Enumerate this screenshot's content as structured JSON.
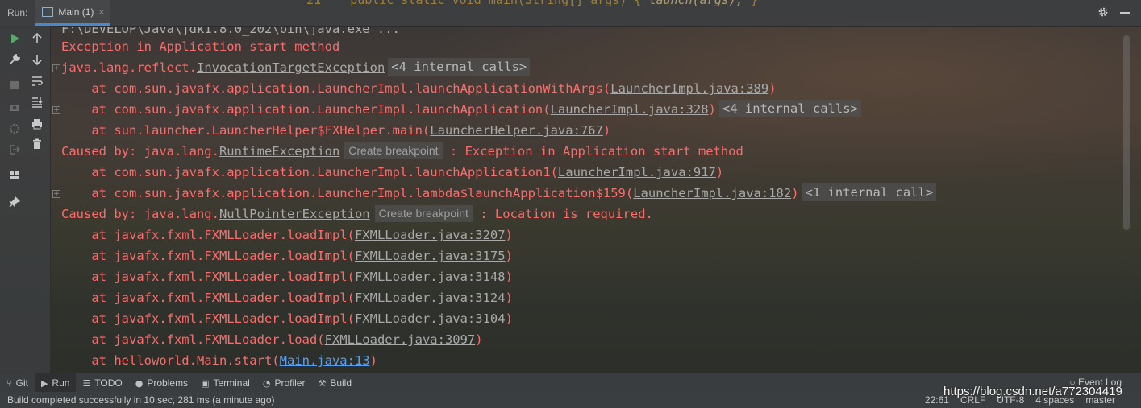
{
  "top": {
    "run_label": "Run:",
    "tab_label": "Main (1)",
    "tab_close": "×",
    "code_prefix": "21    ",
    "code_text": "public static void main(String[] args) { ",
    "code_italic": "launch(args);",
    "code_suffix": " }"
  },
  "console": {
    "truncated_cmd": "F:\\DEVELOP\\Java\\jdk1.8.0_202\\bin\\java.exe ...",
    "lines": {
      "l1": "Exception in Application start method",
      "l2_pkg": "java.lang.reflect.",
      "l2_cls": "InvocationTargetException",
      "l2_badge": "<4 internal calls>",
      "l3_pre": "    at com.sun.javafx.application.LauncherImpl.launchApplicationWithArgs(",
      "l3_link": "LauncherImpl.java:389",
      "l4_pre": "    at com.sun.javafx.application.LauncherImpl.launchApplication(",
      "l4_link": "LauncherImpl.java:328",
      "l4_badge": "<4 internal calls>",
      "l5_pre": "    at sun.launcher.LauncherHelper$FXHelper.main(",
      "l5_link": "LauncherHelper.java:767",
      "l6_pre": "Caused by: java.lang.",
      "l6_cls": "RuntimeException",
      "l6_bp": "Create breakpoint",
      "l6_msg": " : Exception in Application start method",
      "l7_pre": "    at com.sun.javafx.application.LauncherImpl.launchApplication1(",
      "l7_link": "LauncherImpl.java:917",
      "l8_pre": "    at com.sun.javafx.application.LauncherImpl.lambda$launchApplication$159(",
      "l8_link": "LauncherImpl.java:182",
      "l8_badge": "<1 internal call>",
      "l9_pre": "Caused by: java.lang.",
      "l9_cls": "NullPointerException",
      "l9_bp": "Create breakpoint",
      "l9_msg": " : Location is required.",
      "l10_pre": "    at javafx.fxml.FXMLLoader.loadImpl(",
      "l10_link": "FXMLLoader.java:3207",
      "l11_pre": "    at javafx.fxml.FXMLLoader.loadImpl(",
      "l11_link": "FXMLLoader.java:3175",
      "l12_pre": "    at javafx.fxml.FXMLLoader.loadImpl(",
      "l12_link": "FXMLLoader.java:3148",
      "l13_pre": "    at javafx.fxml.FXMLLoader.loadImpl(",
      "l13_link": "FXMLLoader.java:3124",
      "l14_pre": "    at javafx.fxml.FXMLLoader.loadImpl(",
      "l14_link": "FXMLLoader.java:3104",
      "l15_pre": "    at javafx.fxml.FXMLLoader.load(",
      "l15_link": "FXMLLoader.java:3097",
      "l16_pre": "    at helloworld.Main.start(",
      "l16_link": "Main.java:13",
      "close_paren": ")"
    }
  },
  "toolwindows": [
    {
      "label": "Git",
      "icon": "git-branch-icon"
    },
    {
      "label": "Run",
      "icon": "play-icon"
    },
    {
      "label": "TODO",
      "icon": "list-icon"
    },
    {
      "label": "Problems",
      "icon": "info-icon"
    },
    {
      "label": "Terminal",
      "icon": "terminal-icon"
    },
    {
      "label": "Profiler",
      "icon": "profiler-icon"
    },
    {
      "label": "Build",
      "icon": "hammer-icon"
    }
  ],
  "status": {
    "message": "Build completed successfully in 10 sec, 281 ms (a minute ago)",
    "position": "22:61",
    "line_sep": "CRLF",
    "encoding": "UTF-8",
    "indent": "4 spaces",
    "branch": "master",
    "event_log": "Event Log"
  },
  "watermark": "https://blog.csdn.net/a772304419",
  "colors": {
    "error": "#ff6b6b",
    "link": "#a9a9a9",
    "link_blue": "#5b9ef0",
    "accent_tab": "#4a88c7",
    "run_green": "#59a869"
  }
}
